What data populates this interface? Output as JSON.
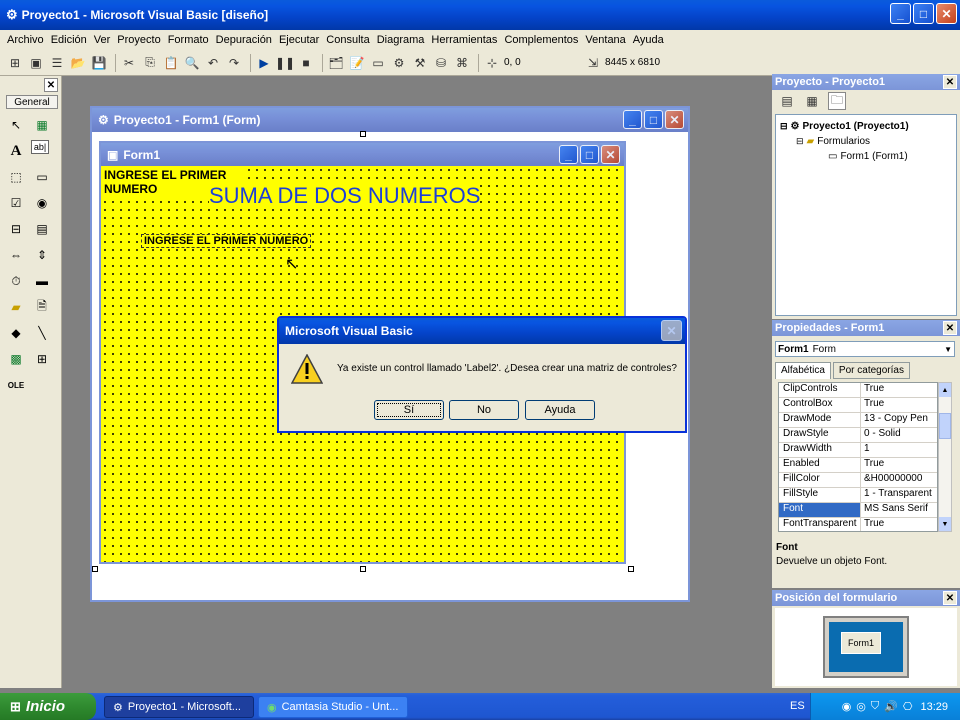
{
  "app": {
    "title": "Proyecto1 - Microsoft Visual Basic [diseño]",
    "icon": "vb-app-icon"
  },
  "menu": [
    "Archivo",
    "Edición",
    "Ver",
    "Proyecto",
    "Formato",
    "Depuración",
    "Ejecutar",
    "Consulta",
    "Diagrama",
    "Herramientas",
    "Complementos",
    "Ventana",
    "Ayuda"
  ],
  "toolbar": {
    "coords": "0, 0",
    "size": "8445 x 6810"
  },
  "toolbox": {
    "title": "General"
  },
  "designer": {
    "title": "Proyecto1 - Form1 (Form)"
  },
  "form": {
    "title": "Form1",
    "label1": "INGRESE EL PRIMER NUMERO",
    "heading": "SUMA DE DOS NUMEROS",
    "label2": "INGRESE EL PRIMER NUMERO",
    "bg_color": "#ffff00",
    "heading_color": "#1c3fd8"
  },
  "dialog": {
    "title": "Microsoft Visual Basic",
    "message": "Ya existe un control llamado 'Label2'. ¿Desea crear una matriz de controles?",
    "yes": "Sí",
    "no": "No",
    "help": "Ayuda"
  },
  "project": {
    "title": "Proyecto - Proyecto1",
    "root": "Proyecto1 (Proyecto1)",
    "folder": "Formularios",
    "item": "Form1 (Form1)"
  },
  "properties": {
    "title": "Propiedades - Form1",
    "object": "Form1",
    "object_type": "Form",
    "tabs": [
      "Alfabética",
      "Por categorías"
    ],
    "rows": [
      {
        "name": "ClipControls",
        "value": "True"
      },
      {
        "name": "ControlBox",
        "value": "True"
      },
      {
        "name": "DrawMode",
        "value": "13 - Copy Pen"
      },
      {
        "name": "DrawStyle",
        "value": "0 - Solid"
      },
      {
        "name": "DrawWidth",
        "value": "1"
      },
      {
        "name": "Enabled",
        "value": "True"
      },
      {
        "name": "FillColor",
        "value": "&H00000000"
      },
      {
        "name": "FillStyle",
        "value": "1 - Transparent"
      },
      {
        "name": "Font",
        "value": "MS Sans Serif"
      },
      {
        "name": "FontTransparent",
        "value": "True"
      }
    ],
    "selected_index": 8,
    "desc_title": "Font",
    "desc_text": "Devuelve un objeto Font."
  },
  "position": {
    "title": "Posición del formulario",
    "preview_label": "Form1"
  },
  "taskbar": {
    "start": "Inicio",
    "tasks": [
      "Proyecto1 - Microsoft...",
      "Camtasia Studio - Unt..."
    ],
    "lang": "ES",
    "clock": "13:29"
  }
}
